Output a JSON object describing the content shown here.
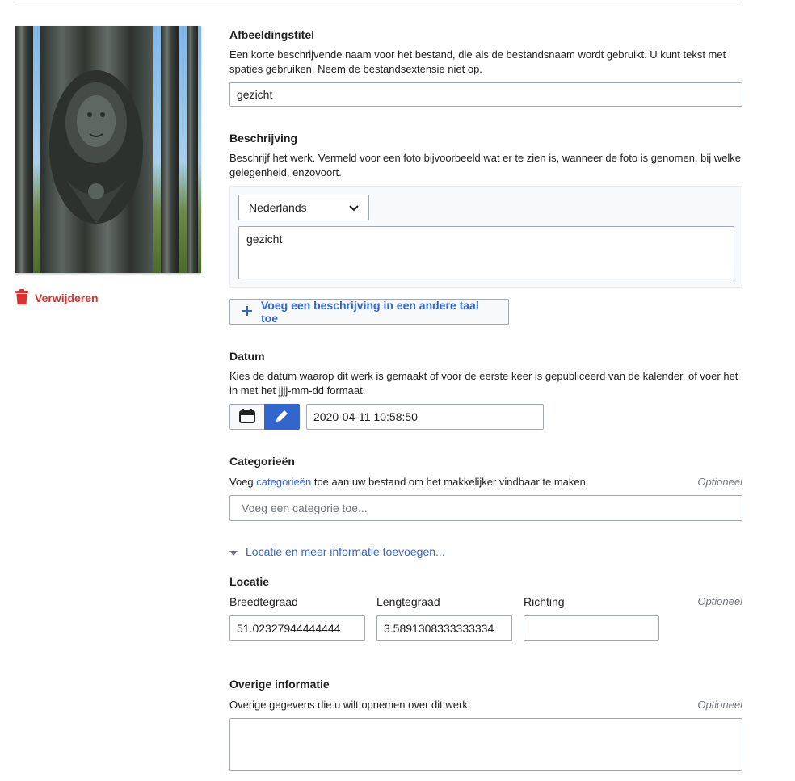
{
  "sidebar": {
    "delete_label": "Verwijderen"
  },
  "title_field": {
    "heading": "Afbeeldingstitel",
    "help": "Een korte beschrijvende naam voor het bestand, die als de bestandsnaam wordt gebruikt. U kunt tekst met spaties gebruiken. Neem de bestandsextensie niet op.",
    "value": "gezicht"
  },
  "description_field": {
    "heading": "Beschrijving",
    "help": "Beschrijf het werk. Vermeld voor een foto bijvoorbeeld wat er te zien is, wanneer de foto is genomen, bij welke gelegenheid, enzovoort.",
    "language": "Nederlands",
    "value": "gezicht",
    "add_button": "Voeg een beschrijving in een andere taal toe"
  },
  "date_field": {
    "heading": "Datum",
    "help": "Kies de datum waarop dit werk is gemaakt of voor de eerste keer is gepubliceerd van de kalender, of voer het in met het jjjj-mm-dd formaat.",
    "value": "2020-04-11 10:58:50"
  },
  "categories_field": {
    "heading": "Categorieën",
    "help_prefix": "Voeg ",
    "help_link": "categorieën",
    "help_suffix": " toe aan uw bestand om het makkelijker vindbaar te maken.",
    "optional": "Optioneel",
    "placeholder": "Voeg een categorie toe..."
  },
  "more_info_toggle": "Locatie en meer informatie toevoegen...",
  "location": {
    "heading": "Locatie",
    "optional": "Optioneel",
    "latitude_label": "Breedtegraad",
    "latitude_value": "51.02327944444444",
    "longitude_label": "Lengtegraad",
    "longitude_value": "3.5891308333333334",
    "heading_label": "Richting",
    "heading_value": ""
  },
  "other_info": {
    "heading": "Overige informatie",
    "help": "Overige gegevens die u wilt opnemen over dit werk.",
    "optional": "Optioneel",
    "value": ""
  },
  "colors": {
    "accent": "#3366cc",
    "destructive": "#d73333"
  }
}
